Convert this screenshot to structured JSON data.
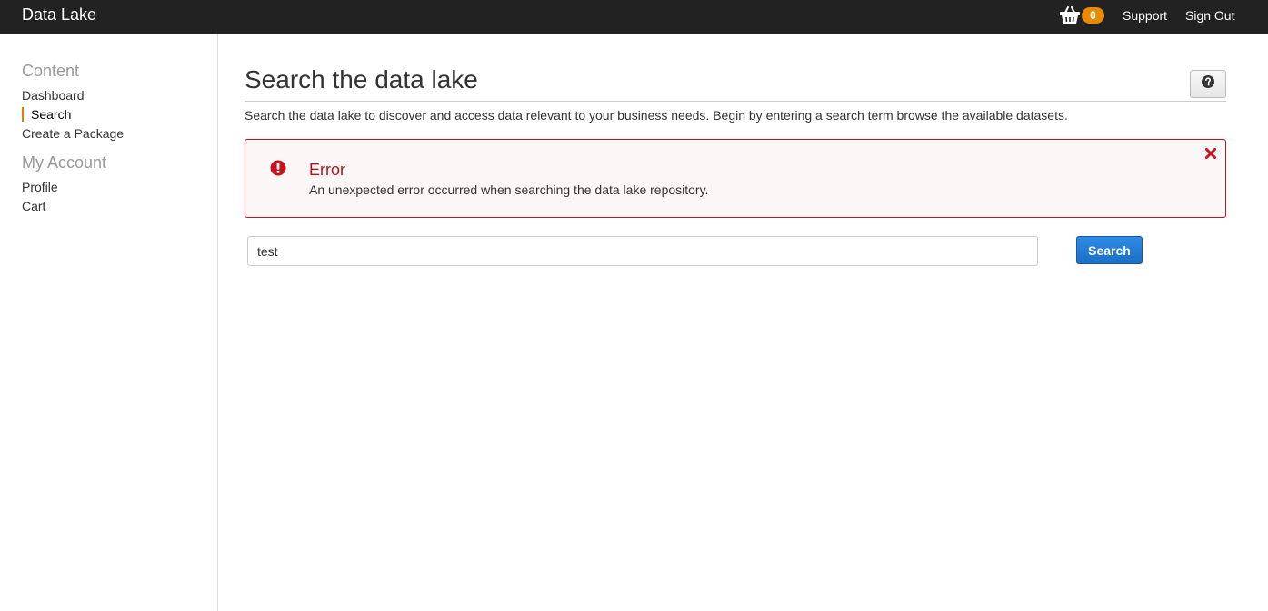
{
  "header": {
    "brand": "Data Lake",
    "cart_count": "0",
    "support_label": "Support",
    "signout_label": "Sign Out"
  },
  "sidebar": {
    "sections": [
      {
        "heading": "Content",
        "items": [
          "Dashboard",
          "Search",
          "Create a Package"
        ]
      },
      {
        "heading": "My Account",
        "items": [
          "Profile",
          "Cart"
        ]
      }
    ],
    "active_item": "Search"
  },
  "main": {
    "title": "Search the data lake",
    "intro": "Search the data lake to discover and access data relevant to your business needs. Begin by entering a search term browse the available datasets.",
    "alert": {
      "title": "Error",
      "message": "An unexpected error occurred when searching the data lake repository."
    },
    "search": {
      "value": "test",
      "button_label": "Search"
    }
  },
  "icons": {
    "cart": "basket-icon",
    "help": "question-circle-icon",
    "alert": "exclamation-circle-icon",
    "close": "close-icon"
  },
  "colors": {
    "topbar": "#222222",
    "badge": "#e98a05",
    "active_marker": "#e9790c",
    "error": "#c7131f",
    "primary_button": "#1a6fc9"
  }
}
